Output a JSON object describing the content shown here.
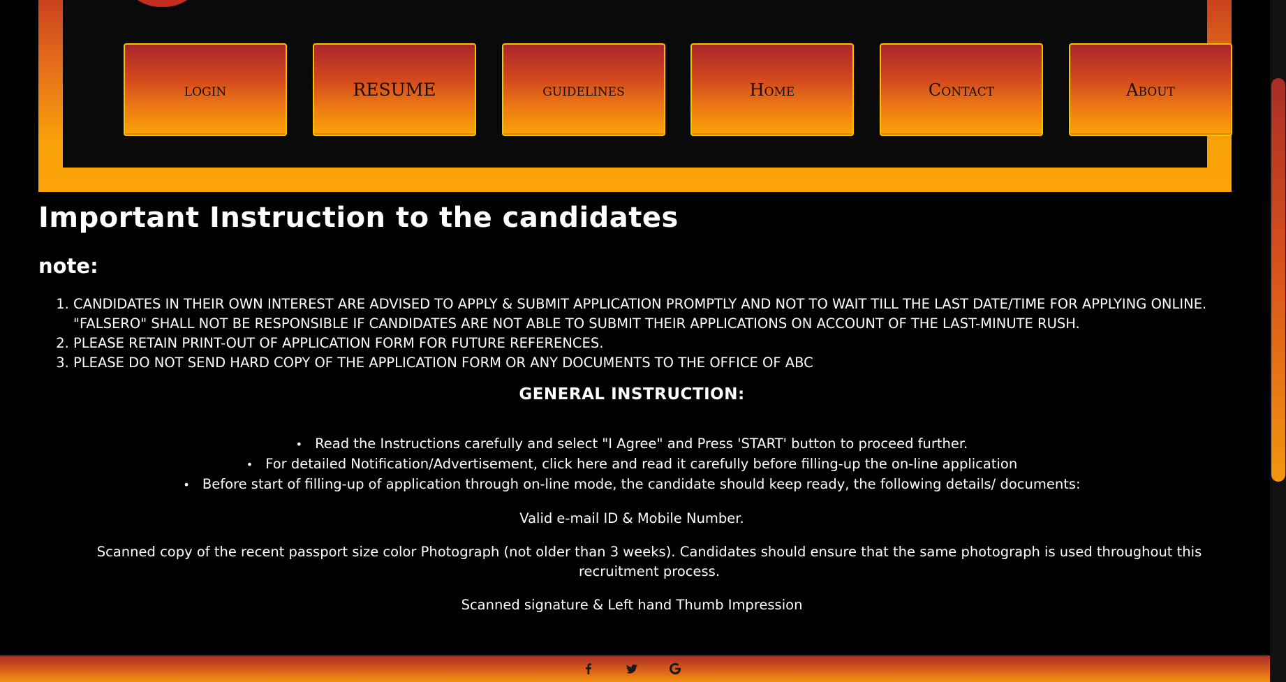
{
  "nav": {
    "items": [
      {
        "label": "login"
      },
      {
        "label": "RESUME"
      },
      {
        "label": "guidelines"
      },
      {
        "label": "Home"
      },
      {
        "label": "Contact"
      },
      {
        "label": "About"
      }
    ]
  },
  "main": {
    "title": "Important Instruction to the candidates",
    "note_heading": "note:",
    "notes": [
      "CANDIDATES IN THEIR OWN INTEREST ARE ADVISED TO APPLY & SUBMIT APPLICATION PROMPTLY AND NOT TO WAIT TILL THE LAST DATE/TIME FOR APPLYING ONLINE. \"FALSERO\" SHALL NOT BE RESPONSIBLE IF CANDIDATES ARE NOT ABLE TO SUBMIT THEIR APPLICATIONS ON ACCOUNT OF THE LAST-MINUTE RUSH.",
      "PLEASE RETAIN PRINT-OUT OF APPLICATION FORM FOR FUTURE REFERENCES.",
      "PLEASE DO NOT SEND HARD COPY OF THE APPLICATION FORM OR ANY DOCUMENTS TO THE OFFICE OF ABC"
    ],
    "general_heading": "GENERAL INSTRUCTION:",
    "general_items": [
      "Read the Instructions carefully and select \"I Agree\" and Press 'START' button to proceed further.",
      "For detailed Notification/Advertisement, click here and read it carefully before filling-up the on-line application",
      "Before start of filling-up of application through on-line mode, the candidate should keep ready, the following details/ documents:"
    ],
    "documents": [
      "Valid e-mail ID & Mobile Number.",
      "Scanned copy of the recent passport size color Photograph (not older than 3 weeks). Candidates should ensure that the same photograph is used throughout this recruitment process.",
      "Scanned signature & Left hand Thumb Impression"
    ]
  },
  "footer": {
    "icons": [
      "facebook-icon",
      "twitter-icon",
      "google-icon"
    ]
  },
  "colors": {
    "accent_dark": "#a92d25",
    "accent_light": "#fba307",
    "button_border": "#f3c300"
  }
}
